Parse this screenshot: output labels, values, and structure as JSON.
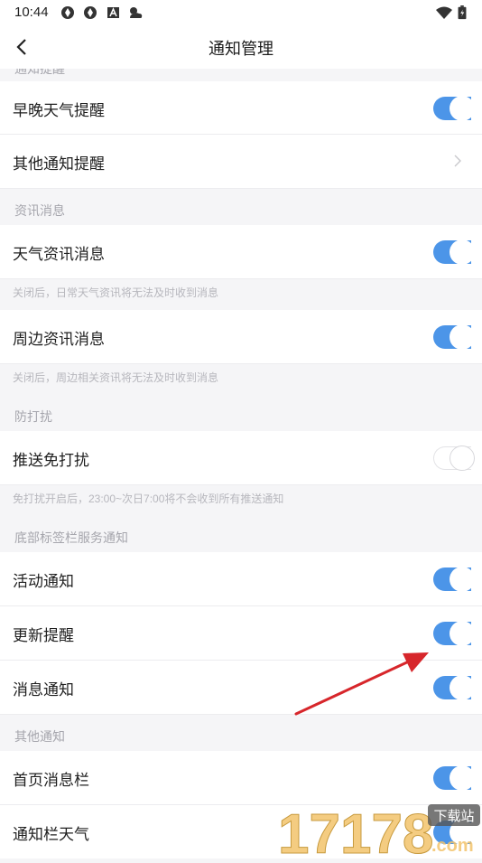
{
  "status_bar": {
    "time": "10:44",
    "icons": [
      "sync-icon",
      "sync-icon",
      "a-icon",
      "weather-icon"
    ],
    "right_icons": [
      "wifi-icon",
      "battery-icon"
    ]
  },
  "nav": {
    "title": "通知管理",
    "back_icon": "back-arrow-icon"
  },
  "sections": {
    "top_partial": "通知提醒",
    "news": "资讯消息",
    "dnd": "防打扰",
    "tab_service": "底部标签栏服务通知",
    "other": "其他通知"
  },
  "rows": {
    "weather_morning_evening": {
      "label": "早晚天气提醒",
      "on": true
    },
    "other_notifications": {
      "label": "其他通知提醒"
    },
    "weather_news": {
      "label": "天气资讯消息",
      "on": true
    },
    "nearby_news": {
      "label": "周边资讯消息",
      "on": true
    },
    "push_dnd": {
      "label": "推送免打扰",
      "on": false
    },
    "activity": {
      "label": "活动通知",
      "on": true
    },
    "update": {
      "label": "更新提醒",
      "on": true
    },
    "message": {
      "label": "消息通知",
      "on": true
    },
    "home_message_bar": {
      "label": "首页消息栏",
      "on": true
    },
    "notification_bar_weather": {
      "label": "通知栏天气",
      "on": true
    }
  },
  "hints": {
    "weather_news": "关闭后，日常天气资讯将无法及时收到消息",
    "nearby_news": "关闭后，周边相关资讯将无法及时收到消息",
    "dnd": "免打扰开启后，23:00~次日7:00将不会收到所有推送通知"
  },
  "watermark": {
    "text": "17178",
    "badge": "下载站",
    "domain": ".com"
  },
  "colors": {
    "toggle_on": "#4c95e8",
    "arrow": "#d7262b",
    "section_bg": "#f5f5f7"
  }
}
